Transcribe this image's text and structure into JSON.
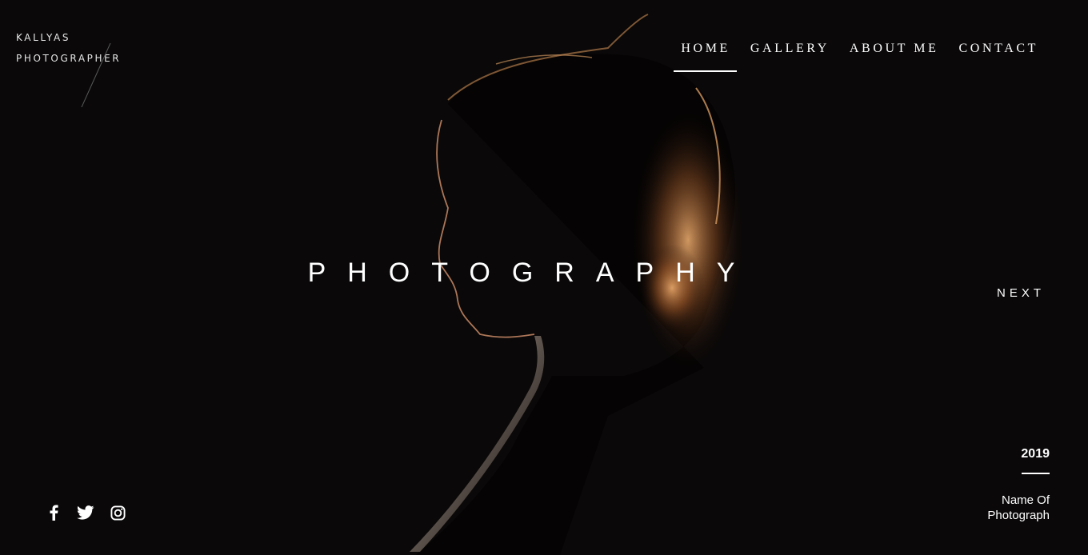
{
  "brand": {
    "line1": "KALLYAS",
    "line2": "PHOTOGRAPHER"
  },
  "nav": {
    "items": [
      {
        "label": "HOME",
        "active": true
      },
      {
        "label": "GALLERY",
        "active": false
      },
      {
        "label": "ABOUT ME",
        "active": false
      },
      {
        "label": "CONTACT",
        "active": false
      }
    ]
  },
  "hero": {
    "title": "PHOTOGRAPHY",
    "next_label": "NEXT"
  },
  "socials": [
    {
      "icon": "facebook-icon"
    },
    {
      "icon": "twitter-icon"
    },
    {
      "icon": "instagram-icon"
    }
  ],
  "caption": {
    "year": "2019",
    "name": "Name Of Photograph"
  },
  "colors": {
    "background": "#0a0808",
    "text": "#ffffff",
    "hair_highlight": "#d9955a"
  }
}
